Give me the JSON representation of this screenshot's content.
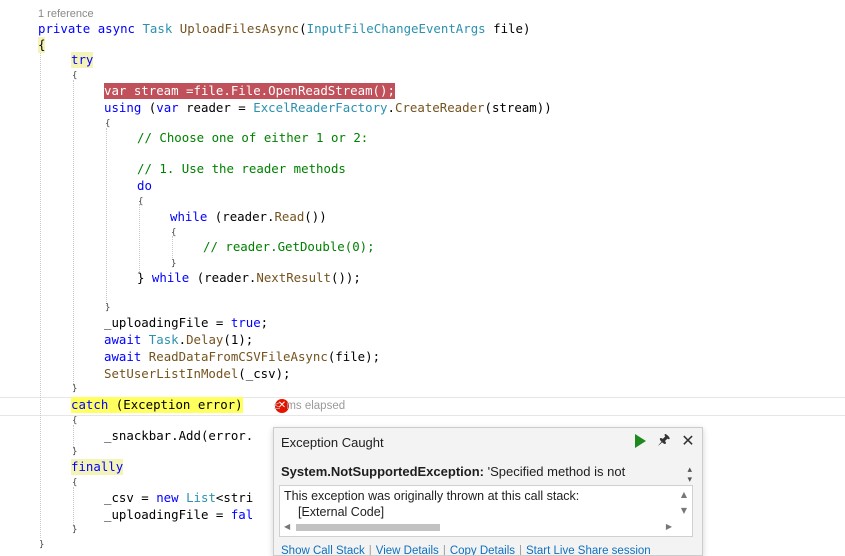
{
  "codelens": {
    "references": "1 reference"
  },
  "code": {
    "method_private": "private",
    "method_async": "async",
    "method_task": "Task",
    "method_name": "UploadFilesAsync",
    "method_paren_open": "(",
    "method_param_type": "InputFileChangeEventArgs",
    "method_param_name": " file)",
    "open_brace": "{",
    "try_kw": "try",
    "try_open": "{",
    "stream_line": "var stream =file.File.OpenReadStream();",
    "using_kw": "using",
    "using_paren": " (",
    "using_var": "var",
    "using_reader": " reader = ",
    "using_factory": "ExcelReaderFactory",
    "using_dot": ".",
    "using_create": "CreateReader",
    "using_rest": "(stream))",
    "using_open": "{",
    "comment_choose": "// Choose one of either 1 or 2:",
    "comment_use": "// 1. Use the reader methods",
    "do_kw": "do",
    "do_open": "{",
    "while_kw": "while",
    "while_read_a": " (reader.",
    "while_read_m": "Read",
    "while_read_b": "())",
    "while_open": "{",
    "comment_getdouble": "// reader.GetDouble(0);",
    "while_close": "}",
    "do_close": "} ",
    "do_while_kw": "while",
    "do_while_a": " (reader.",
    "do_while_m": "NextResult",
    "do_while_b": "());",
    "using_close": "}",
    "uploading_true_a": "_uploadingFile = ",
    "uploading_true_kw": "true",
    "uploading_true_b": ";",
    "await1_kw": "await",
    "await1_ty": " Task",
    "await1_dot": ".",
    "await1_m": "Delay",
    "await1_rest": "(1);",
    "await2_kw": "await",
    "await2_m": " ReadDataFromCSVFileAsync",
    "await2_rest": "(file);",
    "setuser_m": "SetUserListInModel",
    "setuser_rest": "(_csv);",
    "try_close": "}",
    "catch_kw": "catch",
    "catch_rest": " (Exception error)",
    "catch_open": "{",
    "snackbar": "_snackbar.Add(error.",
    "catch_close": "}",
    "finally_kw": "finally",
    "finally_open": "{",
    "csv_a": "_csv = ",
    "csv_new": "new",
    "csv_list": " List",
    "csv_rest": "<stri",
    "uploading_false_a": "_uploadingFile = ",
    "uploading_false_kw": "fal",
    "finally_close": "}",
    "close_brace": "}"
  },
  "perf_tip": {
    "elapsed": "ms elapsed"
  },
  "exception_popup": {
    "title": "Exception Caught",
    "exception_type": "System.NotSupportedException:",
    "exception_message": " 'Specified method is not",
    "stack_header": "This exception was originally thrown at this call stack:",
    "stack_item": "[External Code]",
    "links": [
      "Show Call Stack",
      "View Details",
      "Copy Details",
      "Start Live Share session"
    ],
    "icons": {
      "continue": "play-icon",
      "pin": "pin-icon",
      "close": "close-icon"
    }
  },
  "colors": {
    "keyword": "#0000ff",
    "type": "#2b91af",
    "method": "#74531f",
    "comment": "#008000",
    "error_highlight": "#c0505a",
    "catch_highlight": "#ffff5e",
    "link": "#0e70c0"
  }
}
